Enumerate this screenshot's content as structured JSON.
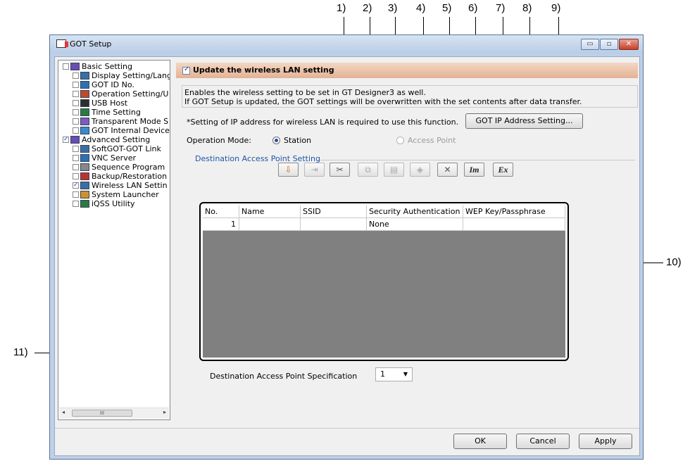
{
  "callouts": {
    "top": [
      "1)",
      "2)",
      "3)",
      "4)",
      "5)",
      "6)",
      "7)",
      "8)",
      "9)"
    ],
    "right": "10)",
    "left": "11)"
  },
  "window": {
    "title": "GOT Setup",
    "min_label": "▭",
    "max_label": "▫",
    "close_label": "✕"
  },
  "tree": {
    "items": [
      {
        "label": "Basic Setting",
        "checked": false,
        "icon": "settings-folder-icon"
      },
      {
        "label": "Display Setting/Lang",
        "checked": false,
        "icon": "display-icon"
      },
      {
        "label": "GOT ID No.",
        "checked": false,
        "icon": "id-icon"
      },
      {
        "label": "Operation Setting/U",
        "checked": false,
        "icon": "operation-icon"
      },
      {
        "label": "USB Host",
        "checked": false,
        "icon": "usb-icon"
      },
      {
        "label": "Time Setting",
        "checked": false,
        "icon": "clock-icon"
      },
      {
        "label": "Transparent Mode S",
        "checked": false,
        "icon": "transparent-icon"
      },
      {
        "label": "GOT Internal Device",
        "checked": false,
        "icon": "device-icon"
      },
      {
        "label": "Advanced Setting",
        "checked": true,
        "icon": "settings-folder-icon"
      },
      {
        "label": "SoftGOT-GOT Link",
        "checked": false,
        "icon": "link-icon"
      },
      {
        "label": "VNC Server",
        "checked": false,
        "icon": "vnc-icon"
      },
      {
        "label": "Sequence Program",
        "checked": false,
        "icon": "sequence-icon"
      },
      {
        "label": "Backup/Restoration",
        "checked": false,
        "icon": "backup-icon"
      },
      {
        "label": "Wireless LAN Settin",
        "checked": true,
        "icon": "wireless-icon"
      },
      {
        "label": "System Launcher",
        "checked": false,
        "icon": "launcher-icon"
      },
      {
        "label": "iQSS Utility",
        "checked": false,
        "icon": "utility-icon"
      }
    ],
    "scroll_thumb": "III"
  },
  "main": {
    "update_label": "Update the wireless LAN setting",
    "update_checked": true,
    "desc_line1": "Enables the wireless setting to be set in GT Designer3 as well.",
    "desc_line2": "If GOT Setup is updated, the GOT settings will be overwritten with the set contents after data transfer.",
    "ip_note": "*Setting of IP address for wireless LAN is required to use this function.",
    "ip_button": "GOT IP Address Setting...",
    "mode_label": "Operation Mode:",
    "mode_station": "Station",
    "mode_access_point": "Access Point",
    "mode_selected": "Station",
    "section_title": "Destination Access Point Setting",
    "toolbar": [
      {
        "name": "add-row",
        "glyph": "⇩",
        "disabled": false
      },
      {
        "name": "insert-row",
        "glyph": "⇥",
        "disabled": true
      },
      {
        "name": "cut",
        "glyph": "✂",
        "disabled": false
      },
      {
        "name": "copy",
        "glyph": "⧉",
        "disabled": true
      },
      {
        "name": "paste",
        "glyph": "▤",
        "disabled": true
      },
      {
        "name": "clear",
        "glyph": "◈",
        "disabled": true
      },
      {
        "name": "delete",
        "glyph": "✕",
        "disabled": false
      },
      {
        "name": "import",
        "glyph": "Im",
        "disabled": false
      },
      {
        "name": "export",
        "glyph": "Ex",
        "disabled": false
      }
    ],
    "table": {
      "columns": [
        "No.",
        "Name",
        "SSID",
        "Security Authentication",
        "WEP Key/Passphrase"
      ],
      "rows": [
        [
          "1",
          "",
          "",
          "None",
          ""
        ]
      ]
    },
    "spec_label": "Destination Access Point Specification",
    "spec_value": "1"
  },
  "footer": {
    "ok": "OK",
    "cancel": "Cancel",
    "apply": "Apply"
  },
  "colors": {
    "header_strip": "#e8b9a0",
    "section_title": "#1f55a6",
    "grid_empty": "#808080"
  }
}
